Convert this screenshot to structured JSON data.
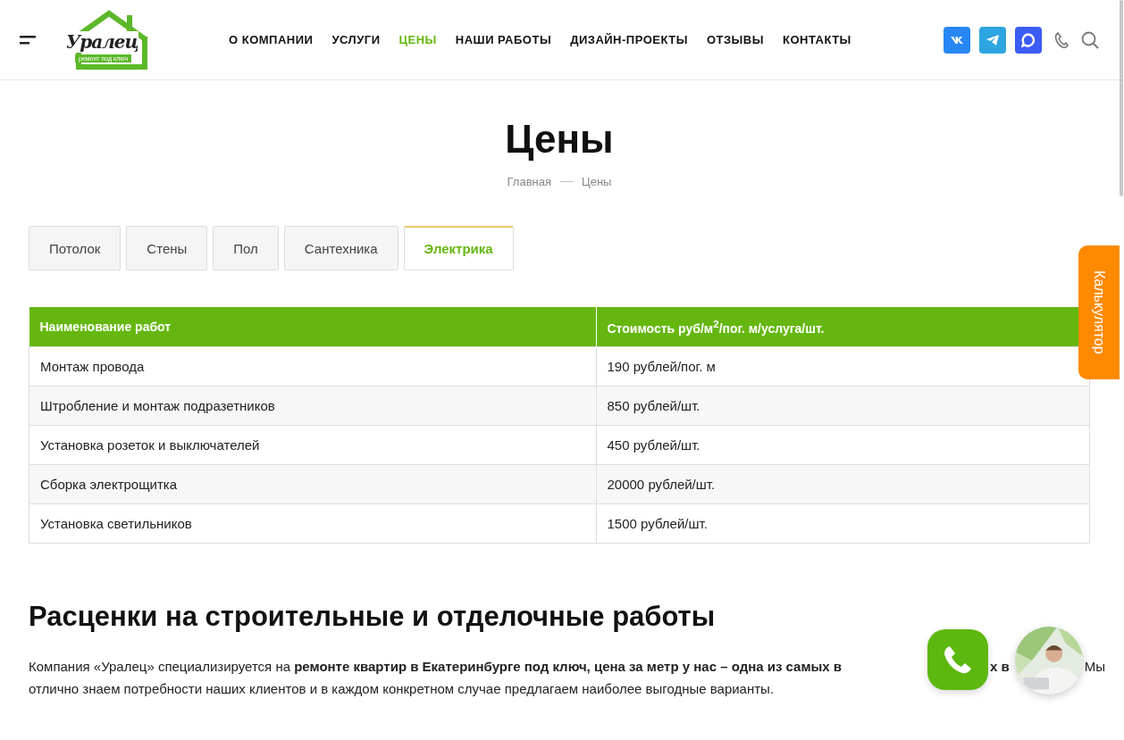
{
  "header": {
    "logo": {
      "name": "Уралец",
      "tagline": "ремонт под ключ"
    },
    "nav": [
      {
        "label": "О КОМПАНИИ",
        "selected": false
      },
      {
        "label": "УСЛУГИ",
        "selected": false
      },
      {
        "label": "ЦЕНЫ",
        "selected": true
      },
      {
        "label": "НАШИ РАБОТЫ",
        "selected": false
      },
      {
        "label": "ДИЗАЙН-ПРОЕКТЫ",
        "selected": false
      },
      {
        "label": "ОТЗЫВЫ",
        "selected": false
      },
      {
        "label": "КОНТАКТЫ",
        "selected": false
      }
    ],
    "social": [
      {
        "kind": "vk",
        "color": "#2787f5"
      },
      {
        "kind": "telegram",
        "color": "#2ca5e0"
      },
      {
        "kind": "chat",
        "color": "#3b5cf5"
      }
    ]
  },
  "page": {
    "title": "Цены",
    "breadcrumbs": [
      "Главная",
      "Цены"
    ]
  },
  "tabs": [
    {
      "label": "Потолок",
      "selected": false
    },
    {
      "label": "Стены",
      "selected": false
    },
    {
      "label": "Пол",
      "selected": false
    },
    {
      "label": "Сантехника",
      "selected": false
    },
    {
      "label": "Электрика",
      "selected": true
    }
  ],
  "table": {
    "columns": [
      "Наименование работ",
      "Стоимость руб/м$^{2}$/пог. м/услуга/шт."
    ],
    "rows": [
      [
        "Монтаж провода",
        "190 рублей/пог. м"
      ],
      [
        "Штробление и монтаж подразетников",
        "850 рублей/шт."
      ],
      [
        "Установка розеток и выключателей",
        "450 рублей/шт."
      ],
      [
        "Сборка электрощитка",
        "20000 рублей/шт."
      ],
      [
        "Установка светильников",
        "1500 рублей/шт."
      ]
    ]
  },
  "article": {
    "heading": "Расценки на строительные и отделочные работы",
    "line_1": [
      "Компания «Уралец» специализируется на **ремонте квартир в Екатеринбурге под ключ, цена за метр у нас – одна из самых в**",
      "**х в**",
      "Мы"
    ],
    "line_2": "отлично знаем потребности наших клиентов и в каждом конкретном случае предлагаем наиболее выгодные варианты."
  },
  "calculator_tab": {
    "label": "Калькулятор"
  }
}
